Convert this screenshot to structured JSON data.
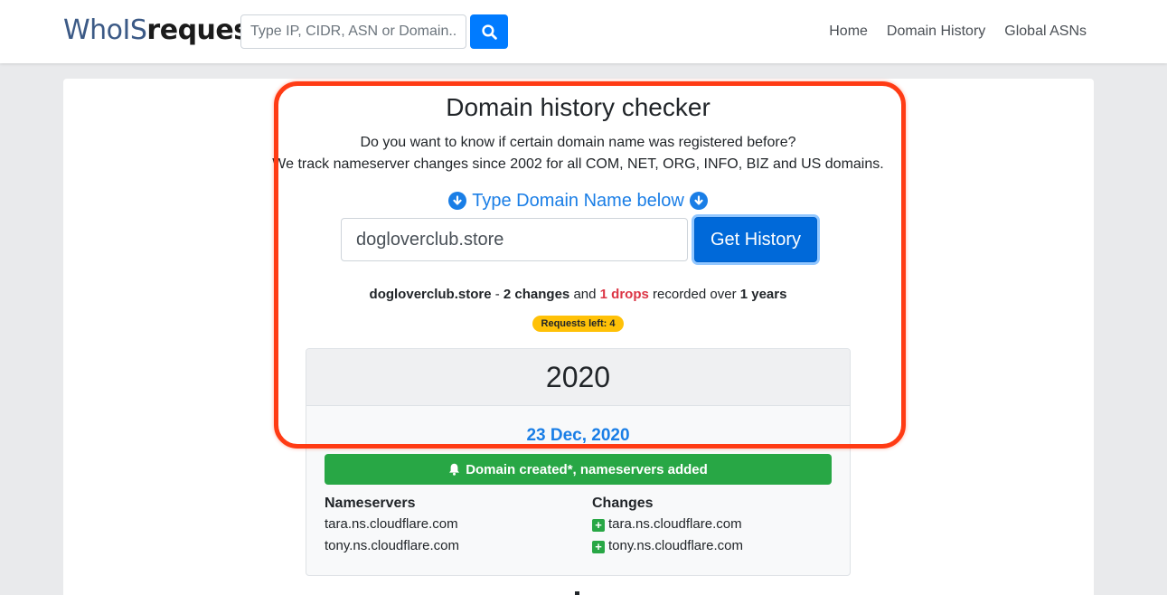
{
  "navbar": {
    "logo_part1": "WhoIS",
    "logo_part2": "request",
    "search_placeholder": "Type IP, CIDR, ASN or Domain..",
    "links": [
      "Home",
      "Domain History",
      "Global ASNs"
    ]
  },
  "checker": {
    "title": "Domain history checker",
    "line1": "Do you want to know if certain domain name was registered before?",
    "line2": "We track nameserver changes since 2002 for all COM, NET, ORG, INFO, BIZ and US domains.",
    "type_label": "Type Domain Name below",
    "domain_value": "dogloverclub.store",
    "button_label": "Get History"
  },
  "summary": {
    "domain": "dogloverclub.store",
    "sep": " - ",
    "changes": "2 changes",
    "and": " and ",
    "drops": "1 drops",
    "recorded": " recorded over ",
    "years": "1 years"
  },
  "badge": "Requests left: 4",
  "history": {
    "year": "2020",
    "date": "23 Dec, 2020",
    "event": "Domain created*, nameservers added",
    "nameservers_header": "Nameservers",
    "changes_header": "Changes",
    "nameservers": [
      "tara.ns.cloudflare.com",
      "tony.ns.cloudflare.com"
    ],
    "changes": [
      "tara.ns.cloudflare.com",
      "tony.ns.cloudflare.com"
    ]
  },
  "colors": {
    "primary": "#007bff",
    "success": "#28a745",
    "danger": "#dc3545",
    "warning": "#ffc107",
    "highlight": "#ff3b14"
  }
}
